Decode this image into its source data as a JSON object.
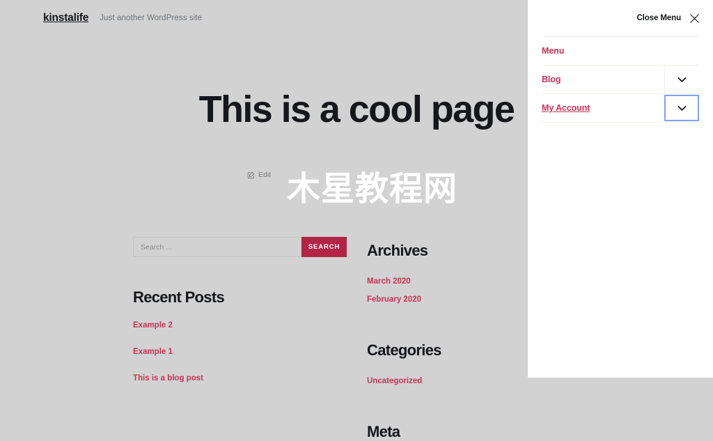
{
  "site": {
    "title": "kinstalife",
    "tagline": "Just another WordPress site"
  },
  "header_nav": [
    {
      "label": "Menu"
    },
    {
      "label": "Blog"
    }
  ],
  "hero": {
    "title": "This is a cool page"
  },
  "edit": {
    "label": "Edit",
    "icon": "pencil-square-icon"
  },
  "watermark": {
    "text": "木星教程网"
  },
  "search": {
    "placeholder": "Search ...",
    "value": "",
    "button_label": "SEARCH"
  },
  "widgets": {
    "recent_posts": {
      "title": "Recent Posts",
      "items": [
        {
          "label": "Example 2"
        },
        {
          "label": "Example 1"
        },
        {
          "label": "This is a blog post"
        }
      ]
    },
    "archives": {
      "title": "Archives",
      "items": [
        {
          "label": "March 2020"
        },
        {
          "label": "February 2020"
        }
      ]
    },
    "categories": {
      "title": "Categories",
      "items": [
        {
          "label": "Uncategorized"
        }
      ]
    },
    "meta": {
      "title": "Meta"
    }
  },
  "menu_panel": {
    "close_label": "Close Menu",
    "close_icon": "close-x-icon",
    "items": [
      {
        "label": "Menu",
        "has_submenu": false
      },
      {
        "label": "Blog",
        "has_submenu": true,
        "toggle_icon": "chevron-down-icon"
      },
      {
        "label": "My Account",
        "has_submenu": true,
        "toggle_icon": "chevron-down-icon"
      }
    ]
  },
  "colors": {
    "accent": "#cc3355",
    "button": "#b32346",
    "page_background": "#d2d2d2",
    "panel_background": "#ffffff",
    "focus_outline": "#7da2f0",
    "divider": "#f2f0ea"
  }
}
